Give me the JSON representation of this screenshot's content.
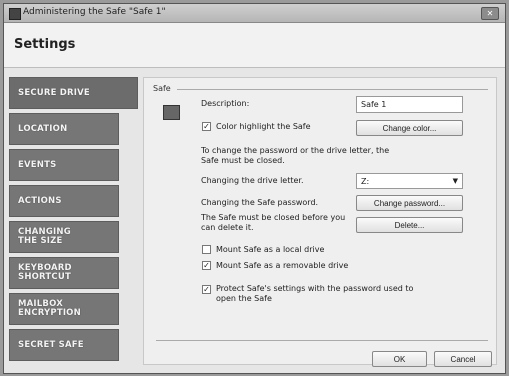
{
  "window": {
    "title": "Administering the Safe \"Safe 1\""
  },
  "header": {
    "title": "Settings"
  },
  "sidebar": {
    "items": [
      {
        "label": "SECURE DRIVE"
      },
      {
        "label": "LOCATION"
      },
      {
        "label": "EVENTS"
      },
      {
        "label": "ACTIONS"
      },
      {
        "label": "CHANGING THE SIZE"
      },
      {
        "label": "KEYBOARD SHORTCUT"
      },
      {
        "label": "MAILBOX ENCRYPTION"
      },
      {
        "label": "SECRET SAFE"
      }
    ]
  },
  "safe_group": {
    "title": "Safe",
    "description_label": "Description:",
    "description_value": "Safe 1",
    "color_highlight_label": "Color highlight the Safe",
    "change_color_button": "Change color...",
    "note": "To change the password or the drive letter, the Safe must be closed.",
    "drive_letter_label": "Changing the drive letter.",
    "drive_letter_value": "Z:",
    "password_label": "Changing the Safe password.",
    "change_password_button": "Change password...",
    "delete_note": "The Safe must be closed before you can delete it.",
    "delete_button": "Delete...",
    "mount_local_label": "Mount Safe as a local drive",
    "mount_removable_label": "Mount Safe as a removable drive",
    "protect_label": "Protect Safe's settings with the password used to open the Safe"
  },
  "checkboxes": {
    "color_highlight": true,
    "mount_local": false,
    "mount_removable": true,
    "protect": true
  },
  "footer": {
    "ok_button": "OK",
    "cancel_button": "Cancel"
  }
}
